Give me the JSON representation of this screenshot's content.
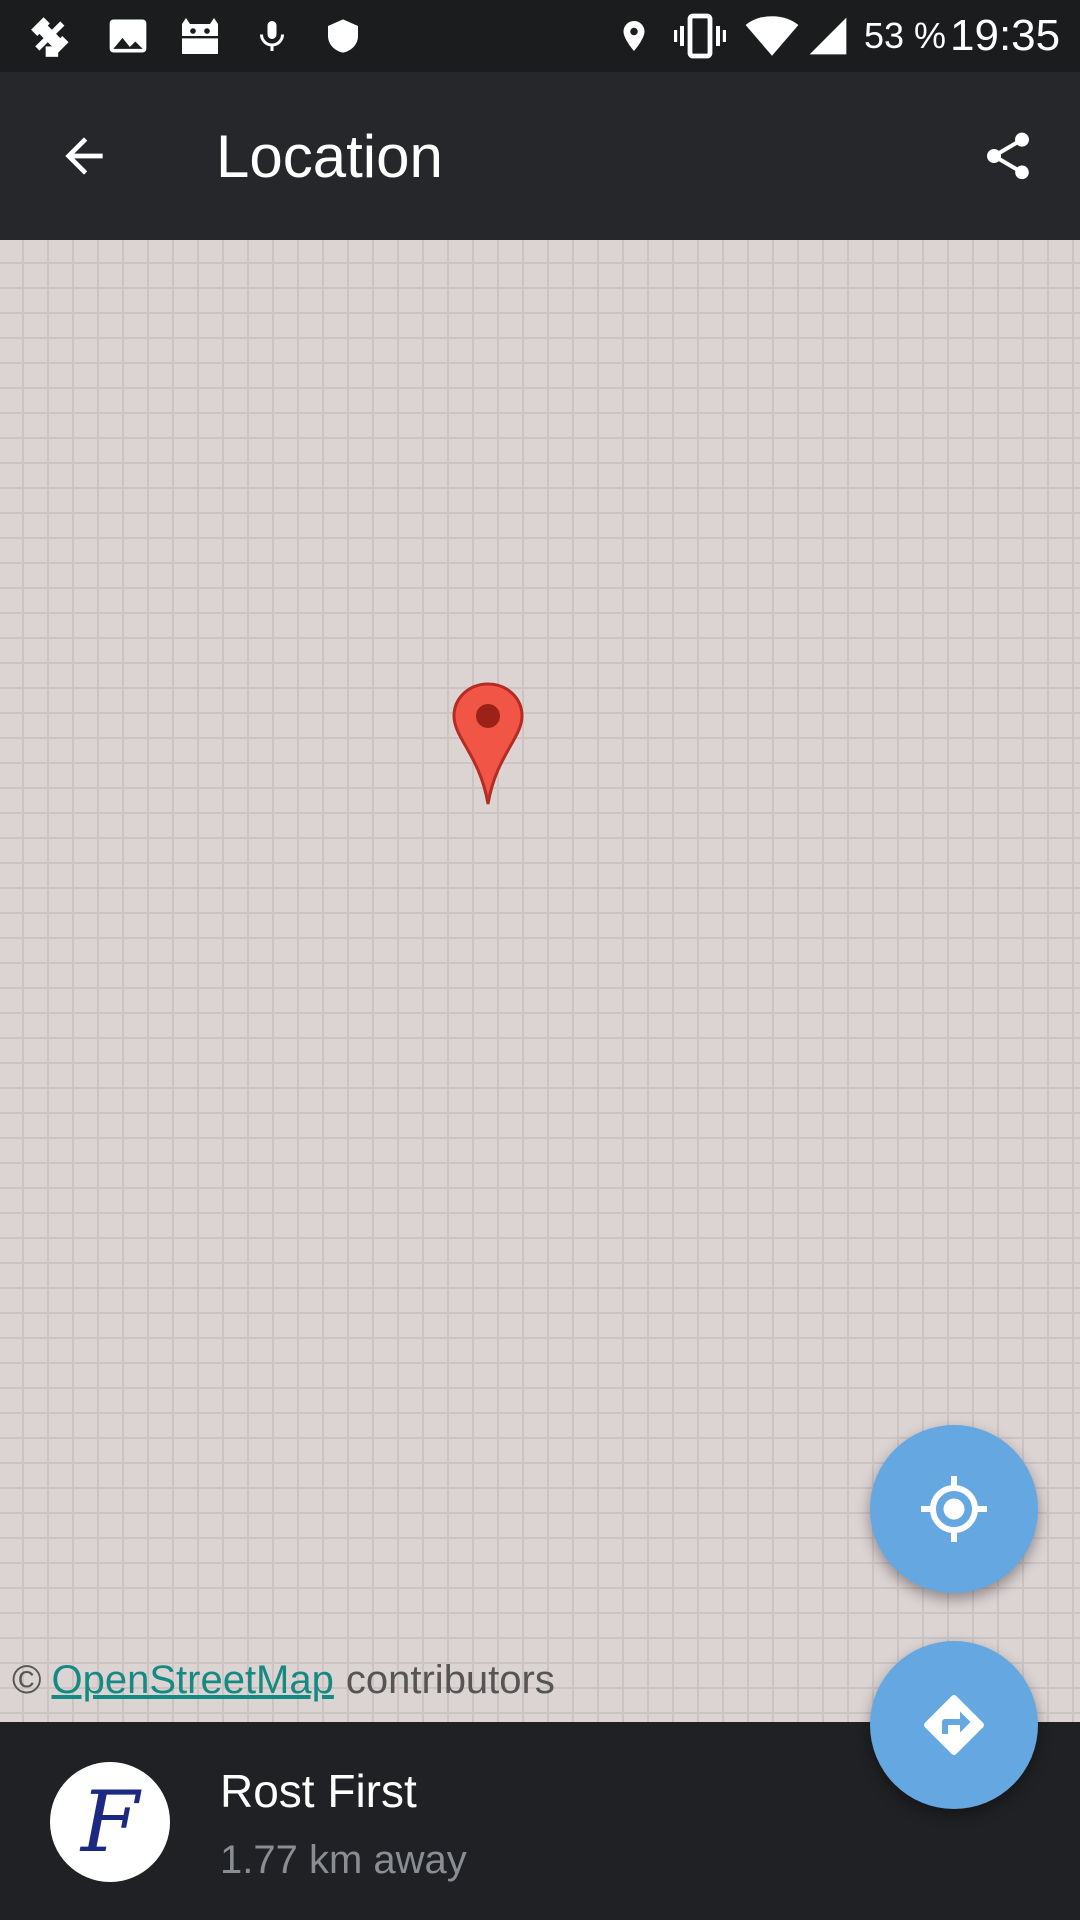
{
  "status_bar": {
    "icons": [
      "usb-debug-icon",
      "image-icon",
      "android-icon",
      "microphone-icon",
      "shield-icon",
      "location-icon",
      "vibrate-icon",
      "wifi-icon",
      "signal-icon"
    ],
    "battery": "53 %",
    "time": "19:35"
  },
  "toolbar": {
    "title": "Location",
    "back_icon": "arrow-back-icon",
    "share_icon": "share-icon"
  },
  "map": {
    "marker": "map-pin-icon",
    "attribution_prefix": "©",
    "attribution_link": "OpenStreetMap",
    "attribution_suffix": "contributors"
  },
  "place": {
    "name": "Rost First",
    "distance": "1.77 km away",
    "avatar_letter": "F"
  },
  "actions": {
    "locate_icon": "my-location-icon",
    "directions_icon": "directions-icon"
  },
  "colors": {
    "toolbar": "#25272a",
    "statusbar": "#1b1c1e",
    "fab": "#64a7e1",
    "link": "#148a82",
    "map_bg": "#dcd3d3",
    "pin": "#e8453c"
  }
}
